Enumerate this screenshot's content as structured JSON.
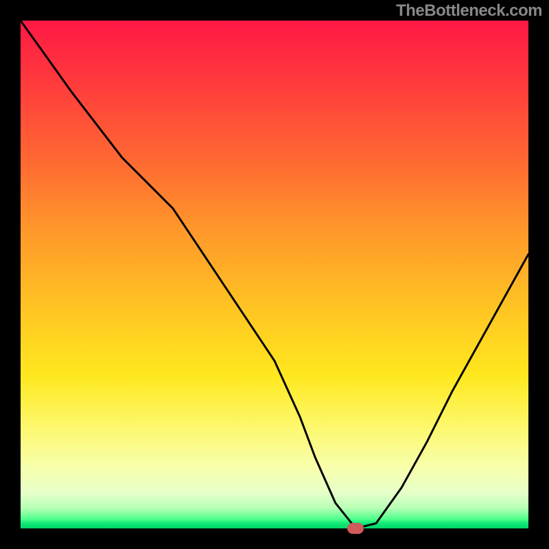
{
  "watermark": "TheBottleneck.com",
  "chart_data": {
    "type": "line",
    "title": "",
    "xlabel": "",
    "ylabel": "",
    "x_range": [
      0,
      100
    ],
    "y_range": [
      0,
      100
    ],
    "series": [
      {
        "name": "bottleneck-curve",
        "x": [
          0,
          5,
          10,
          20,
          30,
          40,
          50,
          55,
          58,
          62,
          66,
          70,
          75,
          80,
          85,
          90,
          95,
          100
        ],
        "y": [
          100,
          93,
          86,
          73,
          63,
          48,
          33,
          22,
          14,
          5,
          0,
          1,
          8,
          17,
          27,
          36,
          45,
          54
        ]
      }
    ],
    "marker": {
      "x": 66,
      "y": 0
    },
    "colors": {
      "curve": "#000000",
      "marker": "#d15b5b",
      "gradient_top": "#ff1846",
      "gradient_mid": "#ffe81e",
      "gradient_bottom": "#00d66a"
    }
  }
}
